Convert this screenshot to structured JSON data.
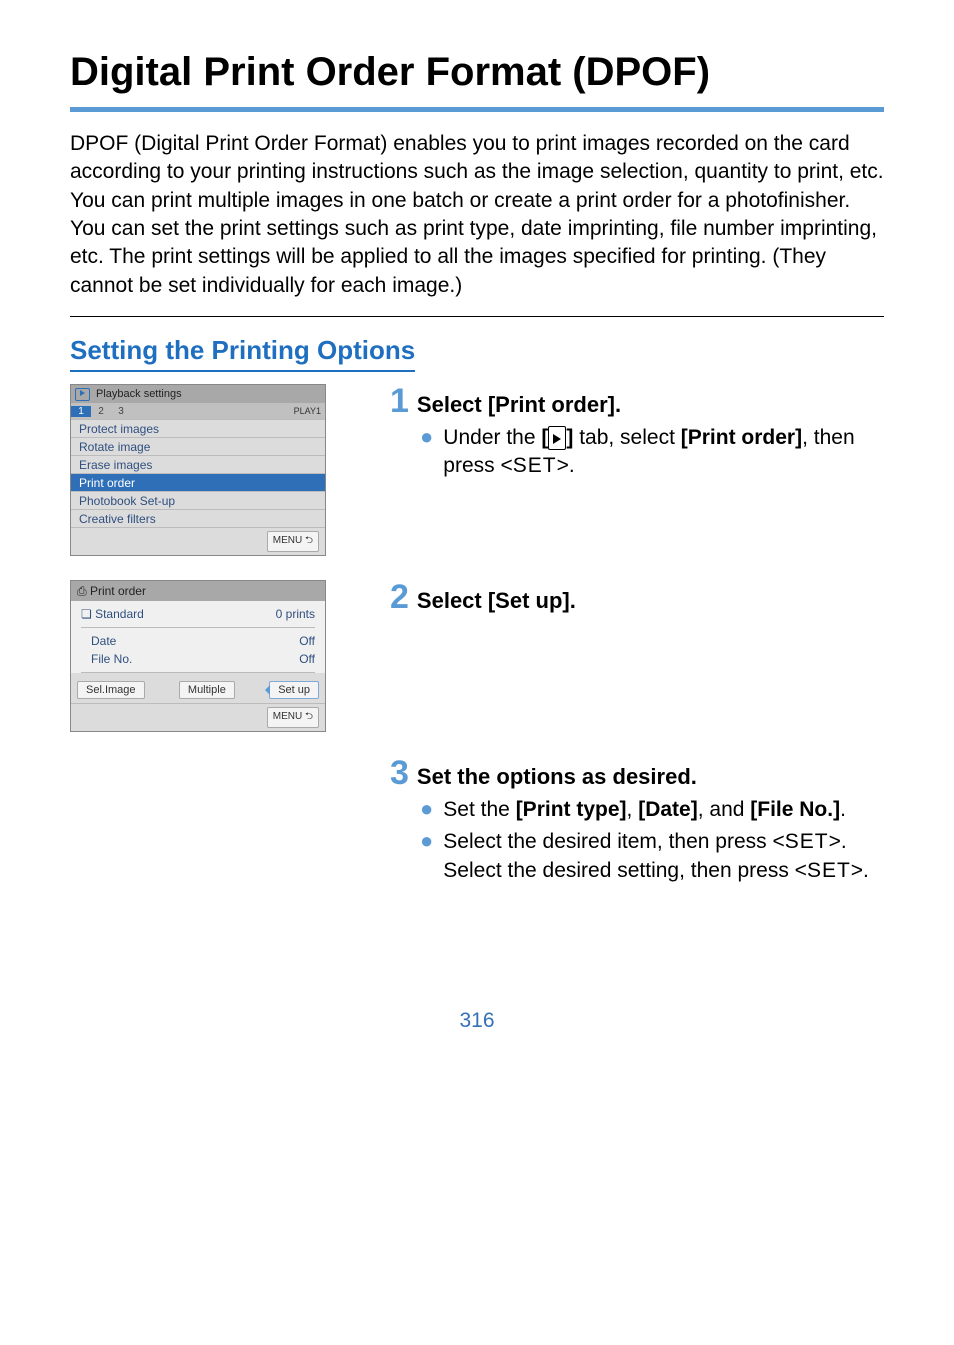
{
  "title": "Digital Print Order Format (DPOF)",
  "intro_p1": "DPOF (Digital Print Order Format) enables you to print images recorded on the card according to your printing instructions such as the image selection, quantity to print, etc. You can print multiple images in one batch or create a print order for a photofinisher.",
  "intro_p2": "You can set the print settings such as print type, date imprinting, file number imprinting, etc. The print settings will be applied to all the images specified for printing. (They cannot be set individually for each image.)",
  "section_heading": "Setting the Printing Options",
  "cam1": {
    "header": "Playback settings",
    "tabs": [
      "1",
      "2",
      "3"
    ],
    "tabs_right": "PLAY1",
    "items": [
      "Protect images",
      "Rotate image",
      "Erase images",
      "Print order",
      "Photobook Set-up",
      "Creative filters"
    ],
    "menu_btn": "MENU ⮌"
  },
  "cam2": {
    "title": "Print order",
    "type_label": "Standard",
    "type_value": "0 prints",
    "date_label": "Date",
    "date_value": "Off",
    "file_label": "File No.",
    "file_value": "Off",
    "btn_sel": "Sel.Image",
    "btn_multiple": "Multiple",
    "btn_setup": "Set up",
    "menu_btn": "MENU ⮌"
  },
  "steps": {
    "s1": {
      "title": "Select [Print order].",
      "b1_pre": "Under the ",
      "b1_mid": " tab, select ",
      "b1_bold1": "[",
      "b1_bold2": "]",
      "b1_bold3": "[Print order]",
      "b1_post": ", then press <",
      "b1_set": "SET",
      "b1_end": ">."
    },
    "s2": {
      "title": "Select [Set up]."
    },
    "s3": {
      "title": "Set the options as desired.",
      "b1_pre": "Set the ",
      "b1_bold1": "[Print type]",
      "b1_mid1": ", ",
      "b1_bold2": "[Date]",
      "b1_mid2": ", and ",
      "b1_bold3": "[File No.]",
      "b1_end": ".",
      "b2_pre": "Select the desired item, then press <",
      "b2_set": "SET",
      "b2_mid": ">. Select the desired setting, then press <",
      "b2_set2": "SET",
      "b2_end": ">."
    }
  },
  "page_number": "316"
}
